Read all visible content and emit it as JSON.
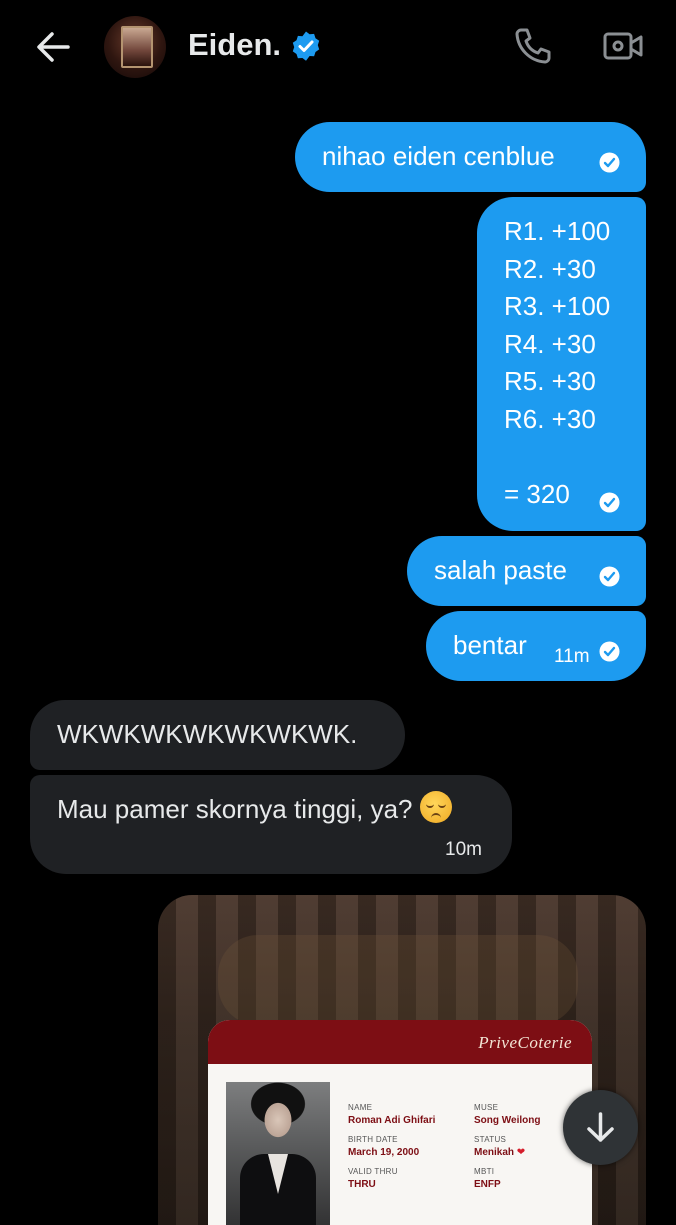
{
  "header": {
    "contact_name": "Eiden.",
    "verified": true
  },
  "messages": {
    "m1": {
      "text": "nihao eiden cenblue",
      "direction": "outgoing",
      "status": "read"
    },
    "m2": {
      "lines": [
        "R1. +100",
        "R2. +30",
        "R3. +100",
        "R4. +30",
        "R5. +30",
        "R6. +30",
        "",
        "= 320"
      ],
      "direction": "outgoing",
      "status": "read"
    },
    "m3": {
      "text": "salah paste",
      "direction": "outgoing",
      "status": "read"
    },
    "m4": {
      "text": "bentar",
      "time": "11m",
      "direction": "outgoing",
      "status": "read"
    },
    "m5": {
      "text": "WKWKWKWKWKWKWK.",
      "direction": "incoming"
    },
    "m6": {
      "text": "Mau pamer skornya tinggi, ya?",
      "emoji": "pensive-face-emoji",
      "time": "10m",
      "direction": "incoming"
    }
  },
  "media_card": {
    "brand": "PriveCoterie",
    "fields": {
      "name_label": "NAME",
      "name_value": "Roman Adi Ghifari",
      "muse_label": "MUSE",
      "muse_value": "Song Weilong",
      "birth_label": "BIRTH DATE",
      "birth_value": "March 19, 2000",
      "status_label": "STATUS",
      "status_value": "Menikah",
      "valid_label": "VALID THRU",
      "valid_value": "THRU",
      "mbti_label": "MBTI",
      "mbti_value": "ENFP"
    }
  },
  "colors": {
    "background": "#000000",
    "outgoing_bubble": "#1d9bf0",
    "incoming_bubble": "#1f2124",
    "card_accent": "#7d0e14"
  }
}
